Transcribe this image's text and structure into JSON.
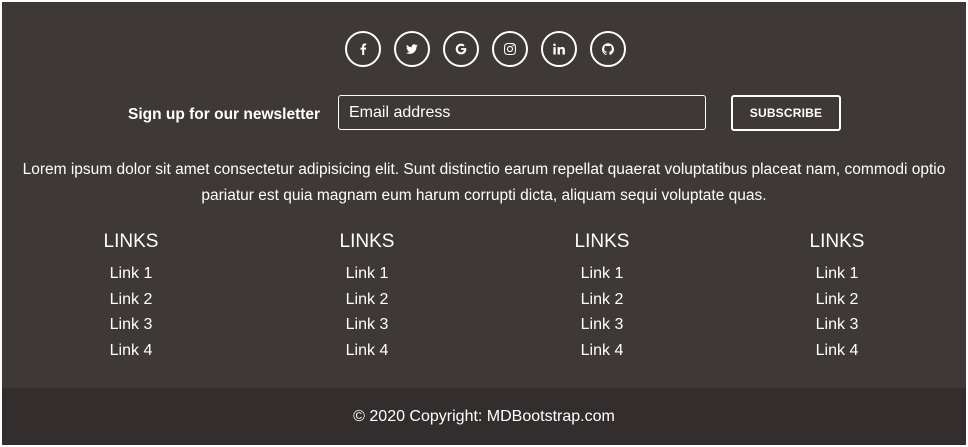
{
  "social": [
    {
      "icon": "facebook-icon",
      "label": "f"
    },
    {
      "icon": "twitter-icon"
    },
    {
      "icon": "google-icon",
      "label": "G"
    },
    {
      "icon": "instagram-icon"
    },
    {
      "icon": "linkedin-icon",
      "label": "in"
    },
    {
      "icon": "github-icon"
    }
  ],
  "newsletter": {
    "label": "Sign up for our newsletter",
    "email_placeholder": "Email address",
    "email_value": "",
    "subscribe_label": "SUBSCRIBE"
  },
  "description": "Lorem ipsum dolor sit amet consectetur adipisicing elit. Sunt distinctio earum repellat quaerat voluptatibus placeat nam, commodi optio pariatur est quia magnam eum harum corrupti dicta, aliquam sequi voluptate quas.",
  "link_columns": [
    {
      "title": "LINKS",
      "items": [
        "Link 1",
        "Link 2",
        "Link 3",
        "Link 4"
      ]
    },
    {
      "title": "LINKS",
      "items": [
        "Link 1",
        "Link 2",
        "Link 3",
        "Link 4"
      ]
    },
    {
      "title": "LINKS",
      "items": [
        "Link 1",
        "Link 2",
        "Link 3",
        "Link 4"
      ]
    },
    {
      "title": "LINKS",
      "items": [
        "Link 1",
        "Link 2",
        "Link 3",
        "Link 4"
      ]
    }
  ],
  "copyright": {
    "text": "© 2020 Copyright: ",
    "link": "MDBootstrap.com"
  },
  "colors": {
    "footer_bg": "#3e3837",
    "copyright_bg": "#332e2d",
    "text": "#ffffff"
  }
}
